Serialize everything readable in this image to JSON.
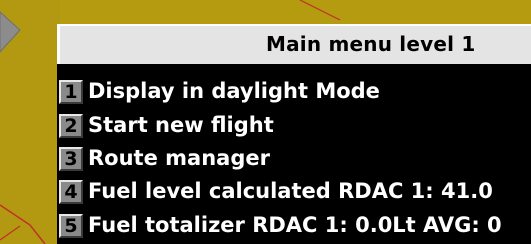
{
  "menu": {
    "title": "Main menu level 1",
    "items": [
      {
        "number": "1",
        "label": "Display in daylight Mode"
      },
      {
        "number": "2",
        "label": "Start new flight"
      },
      {
        "number": "3",
        "label": "Route manager"
      },
      {
        "number": "4",
        "label": "Fuel level calculated RDAC 1: 41.0"
      },
      {
        "number": "5",
        "label": "Fuel totalizer RDAC 1: 0.0Lt AVG: 0"
      }
    ]
  },
  "colors": {
    "map_background": "#b49b10",
    "map_line": "#c0302a",
    "menu_background": "#000000",
    "header_background": "#e4e4e4",
    "item_text": "#ffffff"
  },
  "icons": {
    "map_marker": "gray-triangle-marker-icon"
  }
}
